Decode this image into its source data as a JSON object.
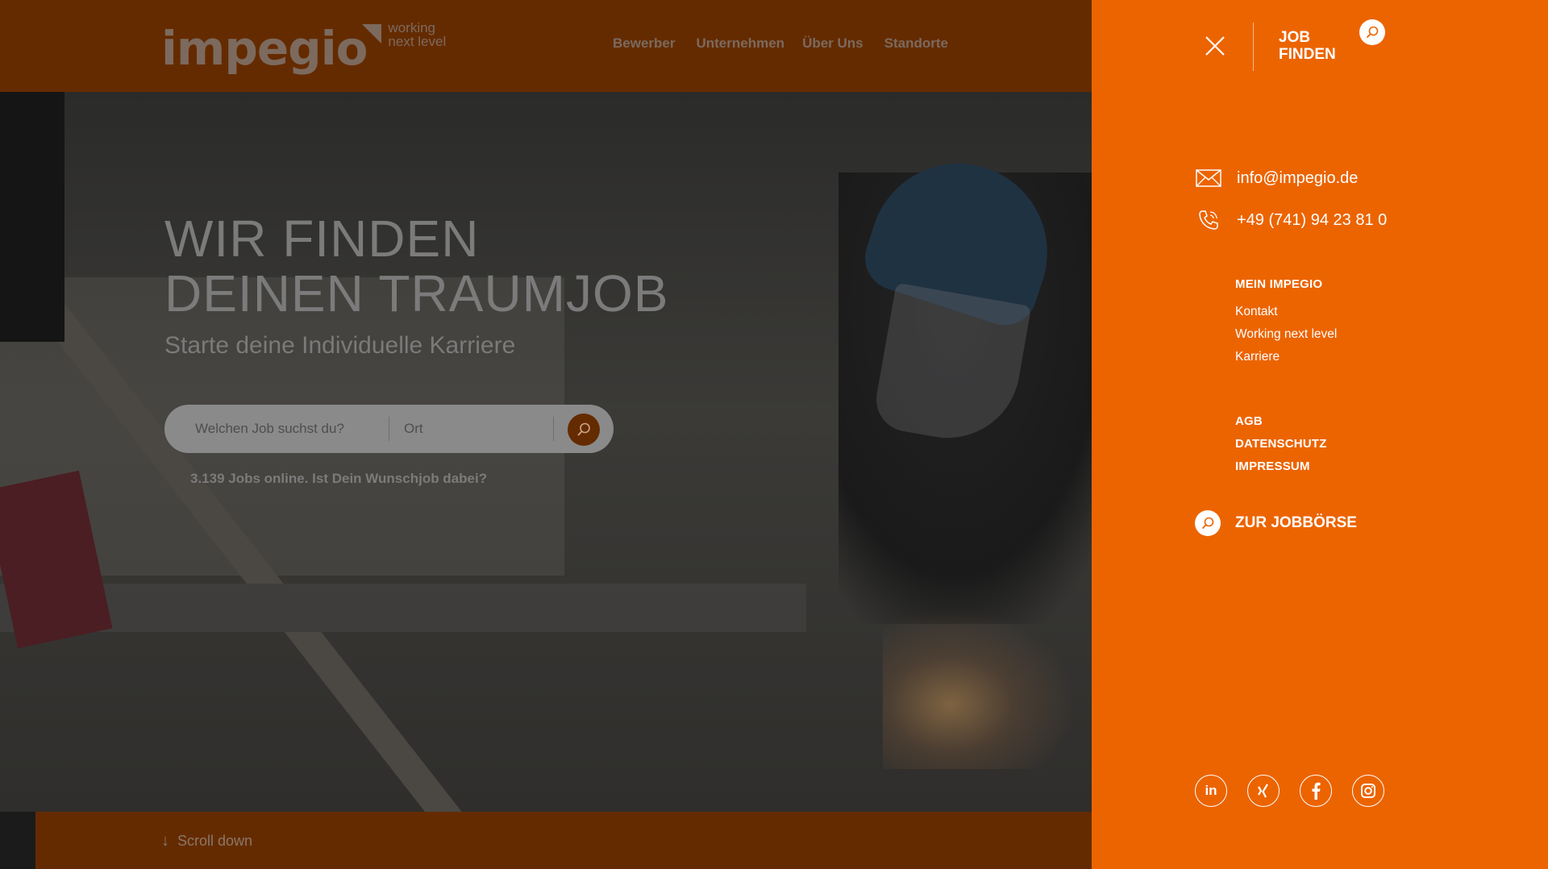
{
  "header": {
    "logo_text": "impegio",
    "logo_tagline_1": "working",
    "logo_tagline_2": "next level",
    "nav": [
      "Bewerber",
      "Unternehmen",
      "Über Uns",
      "Standorte"
    ]
  },
  "hero": {
    "title_line1": "WIR FINDEN",
    "title_line2": "DEINEN TRAUMJOB",
    "subtitle": "Starte deine Individuelle Karriere",
    "search": {
      "job_placeholder": "Welchen Job suchst du?",
      "location_placeholder": "Ort"
    },
    "jobs_online": "3.139 Jobs online. Ist Dein Wunschjob dabei?"
  },
  "scroll": {
    "label": "Scroll down"
  },
  "panel": {
    "job_finden_1": "JOB",
    "job_finden_2": "FINDEN",
    "email": "info@impegio.de",
    "phone": "+49 (741) 94 23 81 0",
    "section_title": "MEIN IMPEGIO",
    "links": [
      "Kontakt",
      "Working next level",
      "Karriere"
    ],
    "legal": [
      "AGB",
      "DATENSCHUTZ",
      "IMPRESSUM"
    ],
    "jobboerse": "ZUR JOBBÖRSE",
    "socials": [
      "linkedin-icon",
      "xing-icon",
      "facebook-icon",
      "instagram-icon"
    ]
  },
  "colors": {
    "accent": "#ec6400",
    "dim_header": "#652b00"
  }
}
